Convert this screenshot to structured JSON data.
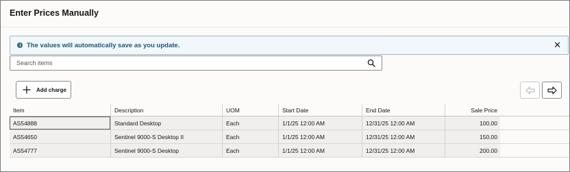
{
  "page": {
    "title": "Enter Prices Manually"
  },
  "banner": {
    "message": "The values will automatically save as you update.",
    "info_icon": "info-icon",
    "close_icon": "close-icon",
    "accent_color": "#1f5876"
  },
  "search": {
    "placeholder": "Search items",
    "value": "",
    "icon": "search-icon"
  },
  "toolbar": {
    "add_charge_label": "Add charge",
    "add_icon": "plus-icon",
    "prev_icon": "arrow-left-icon",
    "next_icon": "arrow-right-icon"
  },
  "table": {
    "columns": [
      "Item",
      "Description",
      "UOM",
      "Start Date",
      "End Date",
      "Sale Price"
    ],
    "rows": [
      {
        "item": "AS54888",
        "description": "Standard Desktop",
        "uom": "Each",
        "start": "1/1/25 12:00 AM",
        "end": "12/31/25 12:00 AM",
        "price": "100.00"
      },
      {
        "item": "AS54650",
        "description": "Sentinel 9000-S Desktop II",
        "uom": "Each",
        "start": "1/1/25 12:00 AM",
        "end": "12/31/25 12:00 AM",
        "price": "150.00"
      },
      {
        "item": "AS54777",
        "description": "Sentinel 9000-S Desktop",
        "uom": "Each",
        "start": "1/1/25 12:00 AM",
        "end": "12/31/25 12:00 AM",
        "price": "200.00"
      }
    ]
  }
}
